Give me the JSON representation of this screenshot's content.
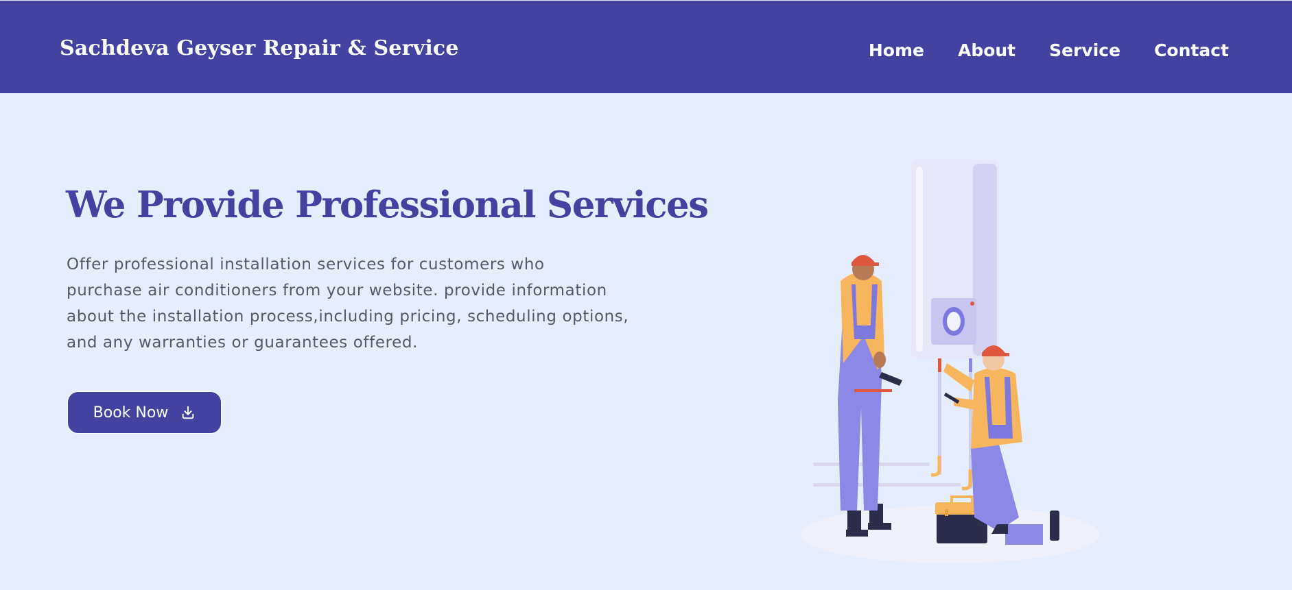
{
  "header": {
    "brand": "Sachdeva Geyser Repair & Service",
    "nav": [
      "Home",
      "About",
      "Service",
      "Contact"
    ]
  },
  "hero": {
    "title": "We Provide Professional Services",
    "description_lines": [
      "Offer professional installation services for customers who",
      "purchase air conditioners from your website. provide information",
      "about the installation process,including pricing, scheduling options,",
      "and any warranties or guarantees offered."
    ],
    "cta_label": "Book Now",
    "cta_icon": "download-icon"
  },
  "illustration": {
    "subject": "technicians-repairing-water-heater"
  },
  "colors": {
    "primary": "#4342a0",
    "background": "#e6eefd",
    "body_text": "#555a66",
    "overalls": "#8b88e6",
    "shirt": "#f7b65e",
    "helmet": "#e0573f"
  }
}
